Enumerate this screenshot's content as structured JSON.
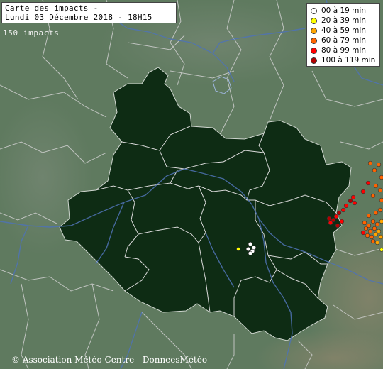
{
  "title": {
    "line1": "Carte des impacts -",
    "line2": "Lundi 03 Décembre 2018 - 18H15"
  },
  "impacts_count": "150 impacts",
  "legend": [
    {
      "label": "00 à 19 min",
      "color": "#ffffff"
    },
    {
      "label": "20 à 39 min",
      "color": "#ffff00"
    },
    {
      "label": "40 à 59 min",
      "color": "#ffa500"
    },
    {
      "label": "60 à 79 min",
      "color": "#ff6400"
    },
    {
      "label": "80 à 99 min",
      "color": "#ff0000"
    },
    {
      "label": "100 à 119 min",
      "color": "#b40000"
    }
  ],
  "credit": "© Association Météo Centre - DonneesMétéo",
  "colors": {
    "land": "#5f7a5f",
    "region": "#0e2c14",
    "borders": "#d8d8d8",
    "rivers": "#4f73b5"
  }
}
